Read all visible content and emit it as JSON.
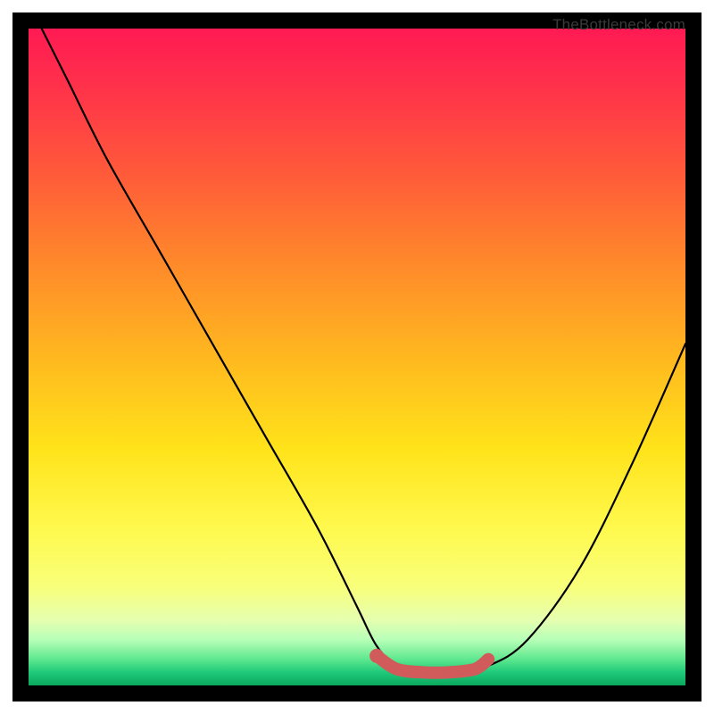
{
  "watermark": "TheBottleneck.com",
  "chart_data": {
    "type": "line",
    "title": "",
    "xlabel": "",
    "ylabel": "",
    "xlim": [
      0,
      100
    ],
    "ylim": [
      0,
      100
    ],
    "series": [
      {
        "name": "black-curve",
        "color": "#000000",
        "x": [
          2,
          6,
          12,
          20,
          28,
          36,
          44,
          50,
          53,
          56,
          60,
          64,
          70,
          76,
          84,
          92,
          100
        ],
        "y": [
          100,
          92,
          80,
          66,
          52,
          38,
          24,
          12,
          6,
          3,
          2,
          2,
          3,
          7,
          18,
          34,
          52
        ]
      },
      {
        "name": "red-highlight",
        "color": "#d15a5a",
        "x": [
          53,
          56,
          60,
          64,
          68,
          70
        ],
        "y": [
          4.5,
          2.5,
          2,
          2,
          2.5,
          4
        ]
      }
    ],
    "annotations": []
  }
}
